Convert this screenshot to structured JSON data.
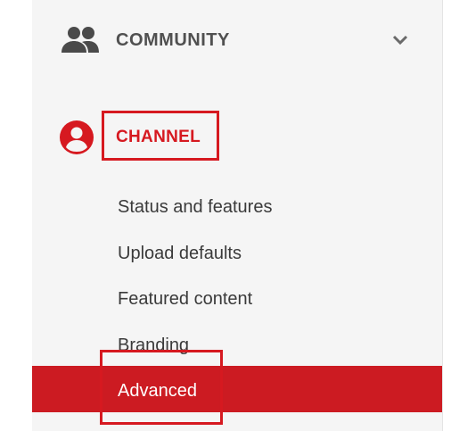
{
  "sidebar": {
    "community": {
      "label": "COMMUNITY",
      "icon": "people-icon",
      "expand_icon": "chevron-down-icon"
    },
    "channel": {
      "label": "CHANNEL",
      "icon": "account-circle-icon",
      "highlighted": true
    },
    "channel_items": [
      {
        "label": "Status and features"
      },
      {
        "label": "Upload defaults"
      },
      {
        "label": "Featured content"
      },
      {
        "label": "Branding"
      },
      {
        "label": "Advanced",
        "selected": true,
        "highlighted": true
      }
    ]
  },
  "colors": {
    "accent_red": "#d61920",
    "selected_bar": "#cc1b22",
    "panel_bg": "#f5f5f5",
    "text_gray": "#3a3a3a",
    "icon_gray": "#4a4a4a"
  }
}
